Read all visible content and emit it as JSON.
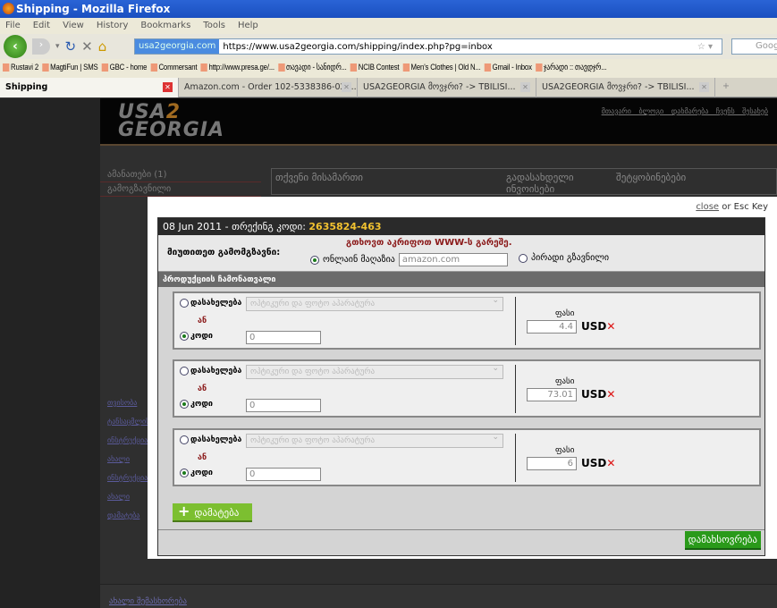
{
  "window": {
    "title": "Shipping - Mozilla Firefox"
  },
  "menu": [
    "File",
    "Edit",
    "View",
    "History",
    "Bookmarks",
    "Tools",
    "Help"
  ],
  "urlbar": {
    "site": "usa2georgia.com",
    "url": "https://www.usa2georgia.com/shipping/index.php?pg=inbox",
    "search": "Googl"
  },
  "bookmarks": [
    "Rustavi 2",
    "MagtiFun | SMS",
    "GBC - home",
    "Commersant",
    "http://www.presa.ge/...",
    "თავადი - სანიდრ...",
    "NCIB Contest",
    "Men's Clothes | Old N...",
    "Gmail - Inbox",
    "ჯარადი :: თავდჯრ..."
  ],
  "tabs": [
    {
      "label": "Shipping"
    },
    {
      "label": "Amazon.com - Order 102-5338386-024..."
    },
    {
      "label": "USA2GEORGIA მოვჯრი? -> TBILISI..."
    },
    {
      "label": "USA2GEORGIA მოვჯრი? -> TBILISI..."
    }
  ],
  "site": {
    "logo_top": "USA",
    "logo_2": "2",
    "logo_bottom": "GEORGIA",
    "toplinks": "მთავარი ბლოგი დახმარება ჩვენს შესახებ",
    "left": [
      "ამანათები (1)",
      "გამოგზავნილი"
    ],
    "col1": "თქვენი მისამართი",
    "col2": "გადასახდელი ინვოისები",
    "col3": "შეტყობინებები",
    "bottom_link": "ახალი შემასხორება",
    "left_links": [
      "თვისობა",
      "ტანსაცმლის",
      "ინსტრუქცია",
      "ახალი",
      "ინსტრუქცია",
      "ახალი",
      "დამატება"
    ]
  },
  "modal": {
    "close_link": "close",
    "close_suffix": " or Esc Key",
    "date": "08 Jun 2011 - თრექინგ კოდი: ",
    "tracking": "2635824-463",
    "sender_label": "მიუთითეთ გამომგზავნი:",
    "warning": "გთხოვთ აკრიფოთ WWW-ს გარეშე.",
    "online_store": "ონლაინ მაღაზია",
    "store_value": "amazon.com",
    "private": "პირადი გზავნილი",
    "product_list": "პროდუქციის ჩამონათვალი",
    "items": [
      {
        "name_label": "დასახელება",
        "category": "ოპტიკური და ფოტო აპარატურა",
        "or": "ან",
        "code_label": "კოდი",
        "code": "0",
        "price_label": "ფასი",
        "price": "4.4",
        "currency": "USD"
      },
      {
        "name_label": "დასახელება",
        "category": "ოპტიკური და ფოტო აპარატურა",
        "or": "ან",
        "code_label": "კოდი",
        "code": "0",
        "price_label": "ფასი",
        "price": "73.01",
        "currency": "USD"
      },
      {
        "name_label": "დასახელება",
        "category": "ოპტიკური და ფოტო აპარატურა",
        "or": "ან",
        "code_label": "კოდი",
        "code": "0",
        "price_label": "ფასი",
        "price": "6",
        "currency": "USD"
      }
    ],
    "add": "დამატება",
    "save": "დამახსოვრება"
  }
}
